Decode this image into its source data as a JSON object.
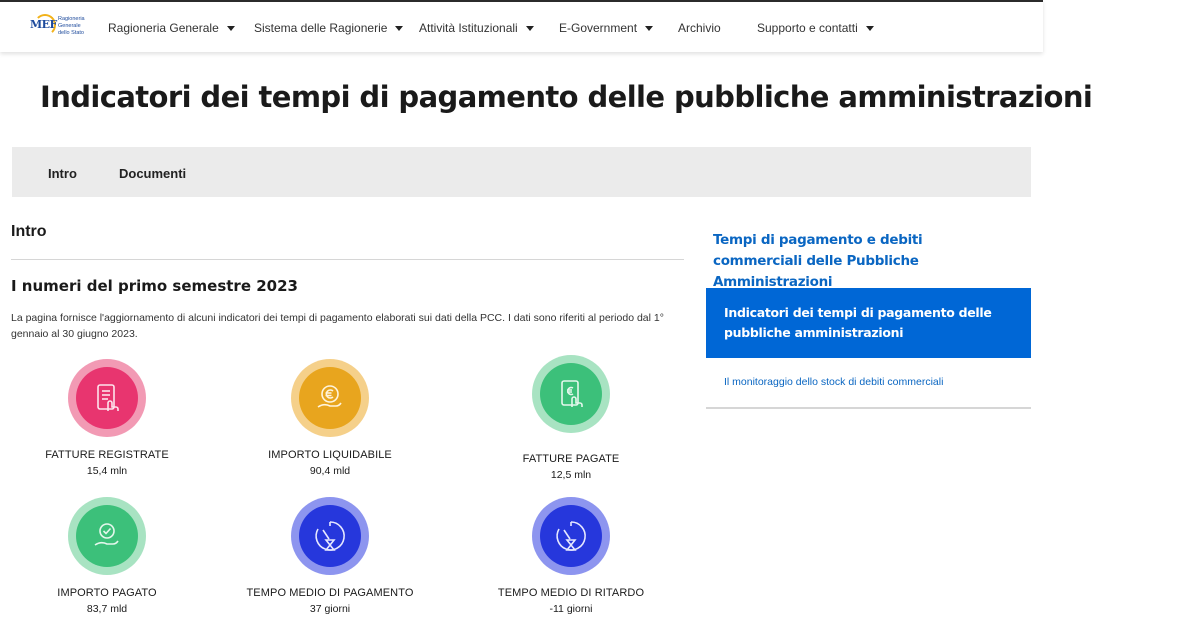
{
  "logo": {
    "mark": "MEF",
    "text": "Ragioneria Generale dello Stato"
  },
  "nav": [
    {
      "label": "Ragioneria Generale",
      "caret": true
    },
    {
      "label": "Sistema delle Ragionerie",
      "caret": true
    },
    {
      "label": "Attività Istituzionali",
      "caret": true
    },
    {
      "label": "E-Government",
      "caret": true
    },
    {
      "label": "Archivio",
      "caret": false
    },
    {
      "label": "Supporto e contatti",
      "caret": true
    }
  ],
  "page_title": "Indicatori dei tempi di pagamento delle pubbliche amministrazioni",
  "tabs": [
    "Intro",
    "Documenti"
  ],
  "section_heading": "Intro",
  "subheading": "I numeri del primo semestre 2023",
  "intro_paragraph": "La pagina fornisce l'aggiornamento di alcuni indicatori dei tempi di pagamento elaborati sui dati della PCC. I dati sono riferiti al periodo dal 1° gennaio al 30 giugno 2023.",
  "stats": [
    {
      "label": "FATTURE REGISTRATE",
      "value": "15,4 mln",
      "icon": "tablet-invoice-icon",
      "outer": "#f29ab4",
      "inner": "#e8356f"
    },
    {
      "label": "IMPORTO LIQUIDABILE",
      "value": "90,4 mld",
      "icon": "euro-coin-hand-icon",
      "outer": "#f5d08a",
      "inner": "#e8a51e"
    },
    {
      "label": "FATTURE PAGATE",
      "value": "12,5 mln",
      "icon": "tablet-euro-icon",
      "outer": "#a8e3c2",
      "inner": "#3cc07a"
    },
    {
      "label": "IMPORTO PAGATO",
      "value": "83,7 mld",
      "icon": "hand-check-icon",
      "outer": "#a8e3c2",
      "inner": "#3cc07a"
    },
    {
      "label": "TEMPO MEDIO DI PAGAMENTO",
      "value": "37 giorni",
      "icon": "clock-hourglass-icon",
      "outer": "#8d95ef",
      "inner": "#2637dc"
    },
    {
      "label": "TEMPO MEDIO DI RITARDO",
      "value": "-11 giorni",
      "icon": "clock-hourglass-icon",
      "outer": "#8d95ef",
      "inner": "#2637dc"
    }
  ],
  "sidebar": {
    "top_link": "Tempi di pagamento e debiti commerciali delle Pubbliche Amministrazioni",
    "active_link": "Indicatori dei tempi di pagamento delle pubbliche amministrazioni",
    "small_link": "Il monitoraggio dello stock di debiti commerciali"
  }
}
